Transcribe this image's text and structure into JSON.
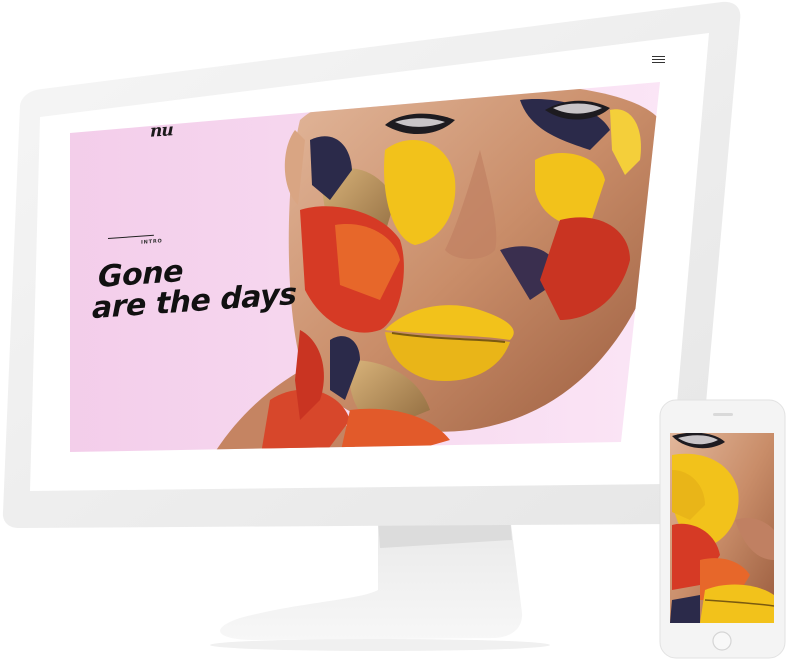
{
  "hero": {
    "title_line_1": "Gone",
    "title_line_2": "are the days",
    "intro_label": "INTRO",
    "logo_text": "nu"
  },
  "icons": {
    "menu": "hamburger-menu-icon",
    "phone_home": "home-button-icon",
    "phone_speaker": "speaker-slot-icon"
  },
  "colors": {
    "background_pink": "#f7d7ef",
    "device_frame": "#f1f1f1",
    "screen_white": "#ffffff",
    "paint_yellow": "#f2c21b",
    "paint_red": "#d63a25",
    "paint_orange": "#e7672a",
    "paint_navy": "#2b2a4a"
  }
}
